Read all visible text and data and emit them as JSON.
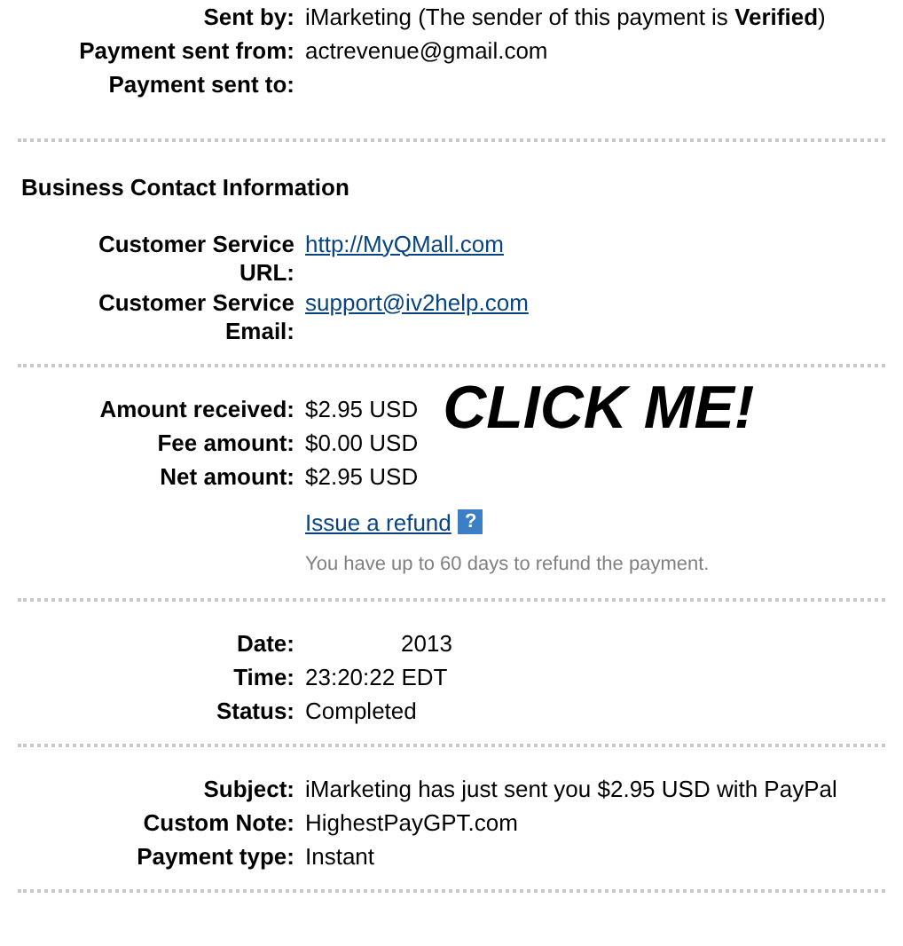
{
  "sections": [
    {
      "rows": [
        {
          "label": "Sent by:",
          "value": "iMarketing (The sender of this payment is **Verified**)",
          "kind": "rich"
        },
        {
          "label": "Payment sent from:",
          "value": "actrevenue@gmail.com",
          "kind": "text"
        },
        {
          "label": "Payment sent to:"
        }
      ]
    },
    {
      "heading": "Business Contact Information",
      "rows": [
        {
          "label": "Customer Service URL:",
          "value": "http://MyQMall.com",
          "kind": "link"
        },
        {
          "label": "Customer Service Email:",
          "value": "support@iv2help.com",
          "kind": "link"
        }
      ]
    },
    {
      "banner": "CLICK ME!",
      "rows": [
        {
          "label": "Amount received:",
          "value": "$2.95 USD",
          "kind": "text"
        },
        {
          "label": "Fee amount:",
          "value": "$0.00 USD",
          "kind": "text"
        },
        {
          "label": "Net amount:",
          "value": "$2.95 USD",
          "kind": "text"
        }
      ],
      "refund": {
        "link": "Issue a refund",
        "help": "?",
        "note": "You have up to 60 days to refund the payment."
      }
    },
    {
      "rows": [
        {
          "label": "Date:",
          "value": "2013",
          "kind": "indented"
        },
        {
          "label": "Time:",
          "value": "23:20:22 EDT",
          "kind": "text"
        },
        {
          "label": "Status:",
          "value": "Completed",
          "kind": "text"
        }
      ]
    },
    {
      "rows": [
        {
          "label": "Subject:",
          "value": "iMarketing has just sent you $2.95 USD with PayPal",
          "kind": "text"
        },
        {
          "label": "Custom Note:",
          "value": "HighestPayGPT.com",
          "kind": "text"
        },
        {
          "label": "Payment type:",
          "value": "Instant",
          "kind": "text"
        }
      ]
    }
  ]
}
